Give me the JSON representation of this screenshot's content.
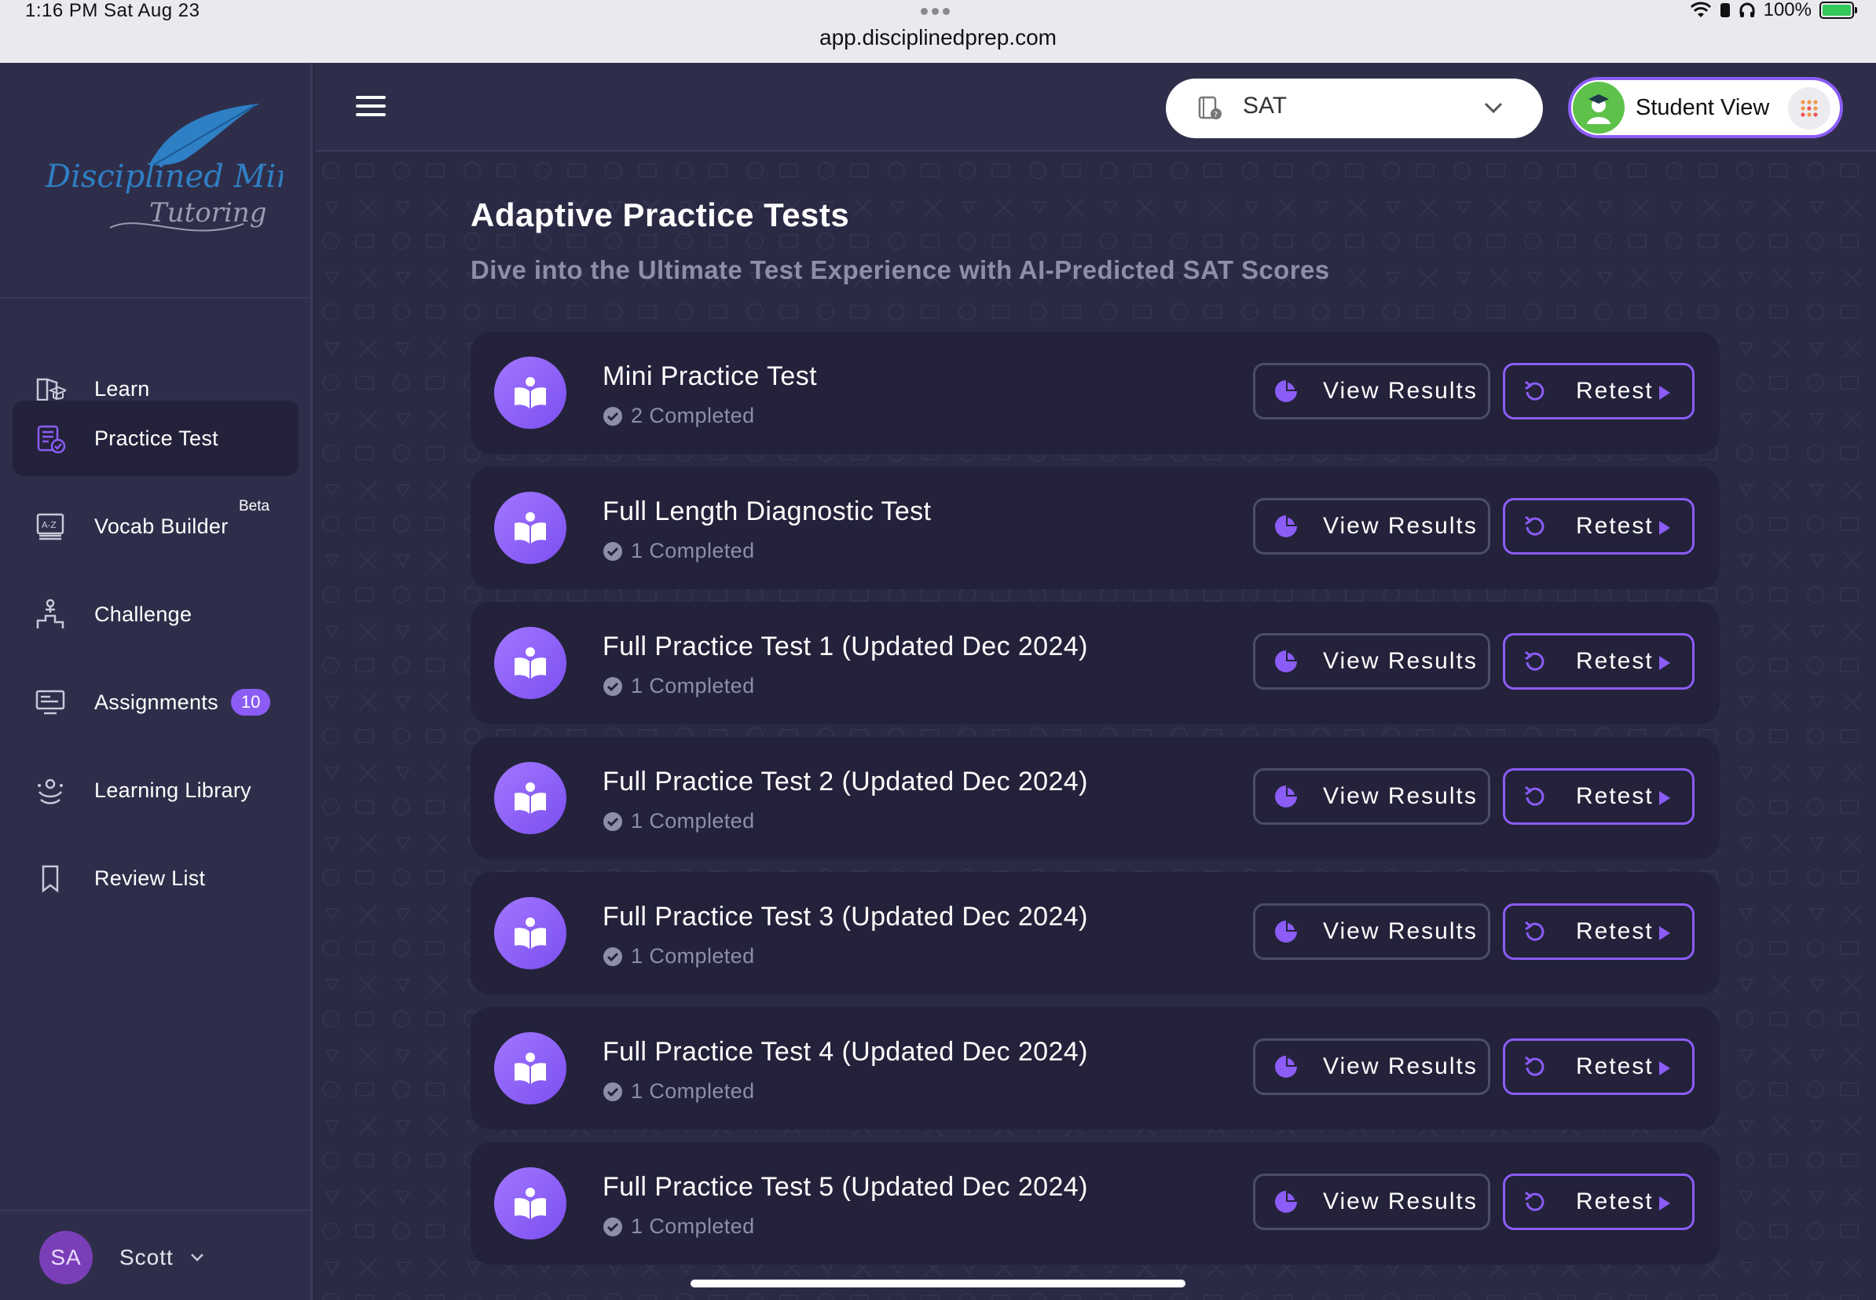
{
  "status_bar": {
    "time": "1:16 PM   Sat Aug 23",
    "battery": "100%",
    "url": "app.disciplinedprep.com"
  },
  "brand": {
    "logo_line1": "Disciplined Minds",
    "logo_line2": "Tutoring",
    "colors": {
      "accent": "#8b5cf6",
      "sidebar": "#2f2e4a",
      "card": "#23223a",
      "logo_blue": "#2f7fc4"
    }
  },
  "sidebar": {
    "items": [
      {
        "label": "Learn",
        "icon": "book-cap-icon"
      },
      {
        "label": "Practice Test",
        "icon": "checklist-icon"
      },
      {
        "label": "Vocab Builder",
        "icon": "vocab-board-icon",
        "tag": "Beta"
      },
      {
        "label": "Challenge",
        "icon": "podium-icon"
      },
      {
        "label": "Assignments",
        "icon": "assignment-icon",
        "count": "10"
      },
      {
        "label": "Learning Library",
        "icon": "library-icon"
      },
      {
        "label": "Review List",
        "icon": "bookmark-icon"
      }
    ],
    "user": {
      "initials": "SA",
      "name": "Scott"
    }
  },
  "header": {
    "exam": "SAT",
    "view_label": "Student View"
  },
  "main": {
    "title": "Adaptive Practice Tests",
    "subtitle": "Dive into the Ultimate Test Experience with AI-Predicted SAT Scores",
    "view_results_label": "View Results",
    "retest_label": "Retest",
    "tests": [
      {
        "name": "Mini Practice Test",
        "status": "2 Completed"
      },
      {
        "name": "Full Length Diagnostic Test",
        "status": "1 Completed"
      },
      {
        "name": "Full Practice Test 1 (Updated Dec 2024)",
        "status": "1 Completed"
      },
      {
        "name": "Full Practice Test 2 (Updated Dec 2024)",
        "status": "1 Completed"
      },
      {
        "name": "Full Practice Test 3 (Updated Dec 2024)",
        "status": "1 Completed"
      },
      {
        "name": "Full Practice Test 4 (Updated Dec 2024)",
        "status": "1 Completed"
      },
      {
        "name": "Full Practice Test 5 (Updated Dec 2024)",
        "status": "1 Completed"
      }
    ]
  }
}
